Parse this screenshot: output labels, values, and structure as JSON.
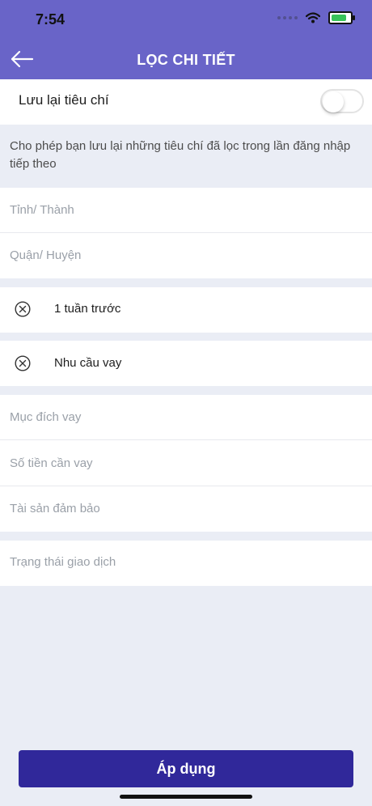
{
  "status": {
    "time": "7:54"
  },
  "header": {
    "title": "LỌC CHI TIẾT"
  },
  "save_criteria": {
    "label": "Lưu lại tiêu chí"
  },
  "hint": {
    "text": "Cho phép bạn lưu lại những tiêu chí đã lọc trong lần đăng nhập tiếp theo"
  },
  "location": {
    "province_placeholder": "Tỉnh/ Thành",
    "district_placeholder": "Quận/ Huyện"
  },
  "active_filters": [
    {
      "label": "1 tuần trước"
    },
    {
      "label": "Nhu cầu vay"
    }
  ],
  "loan_fields": {
    "purpose_placeholder": "Mục đích vay",
    "amount_placeholder": "Số tiền cần vay",
    "collateral_placeholder": "Tài sản đảm bảo"
  },
  "transaction": {
    "status_placeholder": "Trạng thái giao dịch"
  },
  "footer": {
    "apply_label": "Áp dụng"
  }
}
